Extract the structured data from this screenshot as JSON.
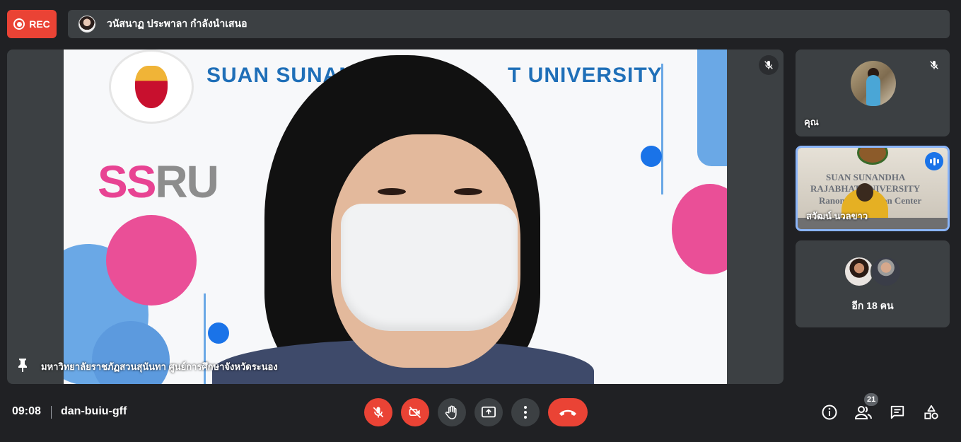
{
  "recording": {
    "label": "REC"
  },
  "presenter_banner": {
    "text": "วนัสนาฏ ประพาลา กำลังนำเสนอ"
  },
  "main_video": {
    "caption": "มหาวิทยาลัยราชภัฏสวนสุนันทา ศูนย์การศึกษาจังหวัดระนอง",
    "backdrop_text_left": "SUAN SUNAN",
    "backdrop_text_right": "T UNIVERSITY",
    "logo_text_a": "SS",
    "logo_text_b": "RU"
  },
  "tiles": {
    "you": {
      "name": "คุณ"
    },
    "speaker": {
      "name": "สวัฒน์ นวลขาว",
      "backdrop_line1": "SUAN SUNANDHA",
      "backdrop_line2": "RAJABHAT UNIVERSITY",
      "backdrop_line3": "Ranong Education Center"
    },
    "others": {
      "label": "อีก 18 คน"
    }
  },
  "bottom_bar": {
    "time": "09:08",
    "meeting_code": "dan-buiu-gff",
    "people_count": "21"
  },
  "colors": {
    "accent_red": "#ea4335",
    "speaking_blue": "#1a73e8",
    "tile_bg": "#3c4043",
    "page_bg": "#202124"
  }
}
